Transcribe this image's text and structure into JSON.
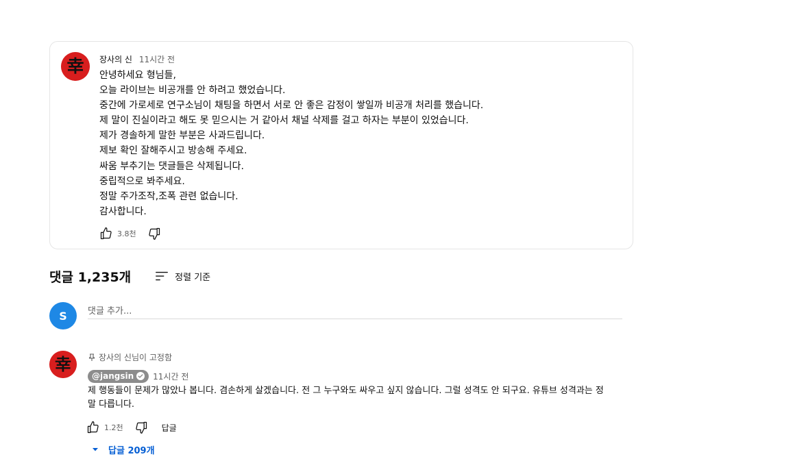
{
  "post": {
    "author": "장사의 신",
    "time": "11시간 전",
    "lines": [
      "안녕하세요 형님들,",
      "오늘 라이브는 비공개를 안 하려고 했었습니다.",
      "중간에 가로세로 연구소님이 채팅을 하면서 서로 안 좋은 감정이 쌓일까 비공개 처리를 했습니다.",
      "제 말이 진실이라고 해도 못 믿으시는 거 같아서 채널 삭제를 걸고 하자는 부분이 있었습니다.",
      "제가 경솔하게 말한 부분은 사과드립니다.",
      "제보 확인 잘해주시고 방송해 주세요.",
      "싸움 부추기는 댓글들은 삭제됩니다.",
      "중립적으로 봐주세요.",
      "정말 주가조작,조폭 관련 없습니다.",
      "감사합니다."
    ],
    "likes": "3.8천",
    "avatar_glyph": "幸"
  },
  "comments": {
    "count_label": "댓글 1,235개",
    "sort_label": "정렬 기준",
    "user_initial": "S",
    "add_placeholder": "댓글 추가..."
  },
  "pinned_comment": {
    "pinned_label": "장사의 신님이 고정함",
    "handle": "@jangsin",
    "time": "11시간 전",
    "text": "제 행동들이 문제가 많았나 봅니다. 겸손하게 살겠습니다. 전 그 누구와도 싸우고 싶지 않습니다. 그럴 성격도 안 되구요. 유튜브 성격과는 정말 다릅니다.",
    "likes": "1.2천",
    "reply_label": "답글",
    "replies_label": "답글 209개",
    "avatar_glyph": "幸"
  },
  "colors": {
    "avatar_red": "#d81e1e",
    "user_avatar_blue": "#1e88e5",
    "link_blue": "#065fd4",
    "chip_gray": "#8c8c8c"
  }
}
